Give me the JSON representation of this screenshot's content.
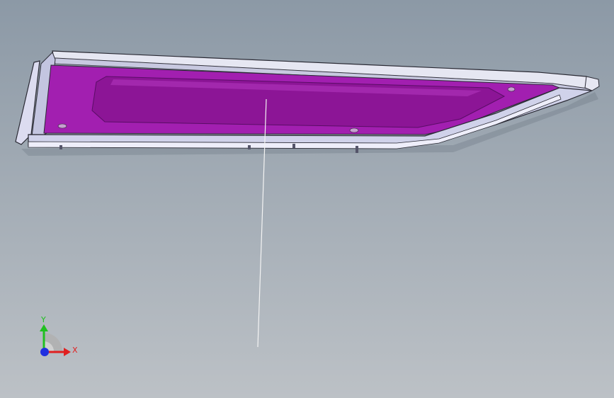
{
  "viewport": {
    "background_top": "#8c99a6",
    "background_bottom": "#bcc1c6"
  },
  "model": {
    "name": "trim-panel-part",
    "panel_color": "#a21fb0",
    "inner_color": "#8c1596",
    "frame_color": "#d6d8ee",
    "edge_color": "#2a2a34"
  },
  "triad": {
    "x_label": "X",
    "y_label": "Y",
    "x_color": "#e02020",
    "y_color": "#20c020",
    "z_color": "#2030e0"
  }
}
